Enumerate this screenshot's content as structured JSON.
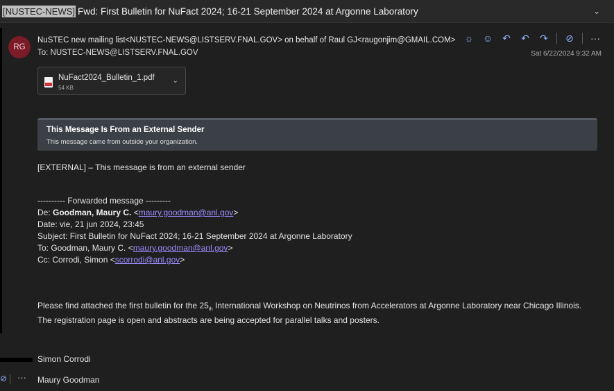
{
  "subject": {
    "tag": "[NUSTEC-NEWS]",
    "text": "Fwd: First Bulletin for NuFact 2024; 16-21 September 2024 at Argonne Laboratory"
  },
  "header": {
    "avatar_initials": "RG",
    "from": "NuSTEC new mailing list<NUSTEC-NEWS@LISTSERV.FNAL.GOV> on behalf of Raul GJ<raugonjim@GMAIL.COM>",
    "to": "To: NUSTEC-NEWS@LISTSERV.FNAL.GOV",
    "date": "Sat 6/22/2024 9:32 AM",
    "actions": {
      "sun": "☼",
      "emoji": "☺",
      "reply": "↶",
      "reply_all": "↶",
      "forward": "↷",
      "tag": "⊘",
      "more": "···"
    },
    "action_icons": [
      "brightness-icon",
      "emoji-icon",
      "reply-icon",
      "reply-all-icon",
      "forward-icon",
      "tag-icon",
      "more-icon"
    ]
  },
  "attachment": {
    "name": "NuFact2024_Bulletin_1.pdf",
    "size": "54 KB"
  },
  "banner": {
    "title": "This Message Is From an External Sender",
    "subtitle": "This message came from outside your organization."
  },
  "body": {
    "external_note": "[EXTERNAL] – This message is from an external sender",
    "fwd_header": "---------- Forwarded message ---------",
    "de_label": "De: ",
    "de_name": "Goodman, Maury C.",
    "de_email": "maury.goodman@anl.gov",
    "date": "Date: vie, 21 jun 2024, 23:45",
    "subject": "Subject: First Bulletin for NuFact 2024; 16-21 September 2024 at Argonne Laboratory",
    "to_label": "To: Goodman, Maury C. ",
    "to_email": "maury.goodman@anl.gov",
    "cc_label": "Cc: Corrodi, Simon ",
    "cc_email": "scorrodi@anl.gov",
    "para_start": "Please find attached the first bulletin for the  25",
    "para_sup": "th",
    "para_end": " International Workshop on Neutrinos from Accelerators at Argonne Laboratory near Chicago Illinois.   The registration page is open and abstracts are being accepted for parallel talks and posters."
  },
  "footer": {
    "name1": "Simon Corrodi",
    "more": "···",
    "name2": "Maury Goodman"
  },
  "colors": {
    "background": "#1f1f1f",
    "avatar": "#7a1b27",
    "link": "#9b8cff",
    "accent": "#8fb3ff"
  }
}
